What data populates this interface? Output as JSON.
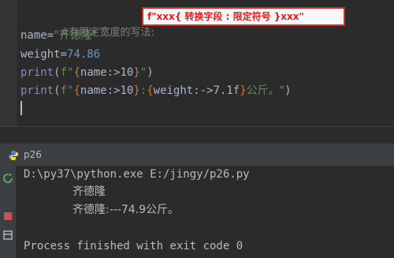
{
  "editor": {
    "lines": {
      "comment": "#有限定宽度的写法:",
      "l2": {
        "name": "name",
        "eq": "=",
        "value": "\"齐德隆\""
      },
      "l3": {
        "name": "weight",
        "eq": "=",
        "value": "74.86"
      },
      "l4": {
        "fn": "print",
        "open": "(",
        "prefix": "f\"",
        "lbrace": "{",
        "expr": "name:>10",
        "rbrace": "}",
        "close_str": "\"",
        "close": ")"
      },
      "l5": {
        "fn": "print",
        "open": "(",
        "prefix": "f\"",
        "lbrace1": "{",
        "expr1": "name:>10",
        "rbrace1": "}",
        "colon": ":",
        "lbrace2": "{",
        "expr2": "weight:->7.1f",
        "rbrace2": "}",
        "tail": "公斤。\"",
        "close": ")"
      }
    },
    "annotation": "f\"xxx{ 转换字段 : 限定符号 }xxx\""
  },
  "run_panel": {
    "tab_title": "p26",
    "icon": "python-icon",
    "console": {
      "command": "D:\\py37\\python.exe E:/jingy/p26.py",
      "out1": "齐德隆",
      "out2": "齐德隆:---74.9公斤。",
      "exit": "Process finished with exit code 0"
    }
  },
  "colors": {
    "background": "#2b2b2b",
    "string": "#6a8759",
    "number": "#6897bb",
    "builtin": "#8888c6",
    "brace": "#cc7832",
    "annotation_border": "#cf2b2b",
    "annotation_text": "#e02020"
  }
}
